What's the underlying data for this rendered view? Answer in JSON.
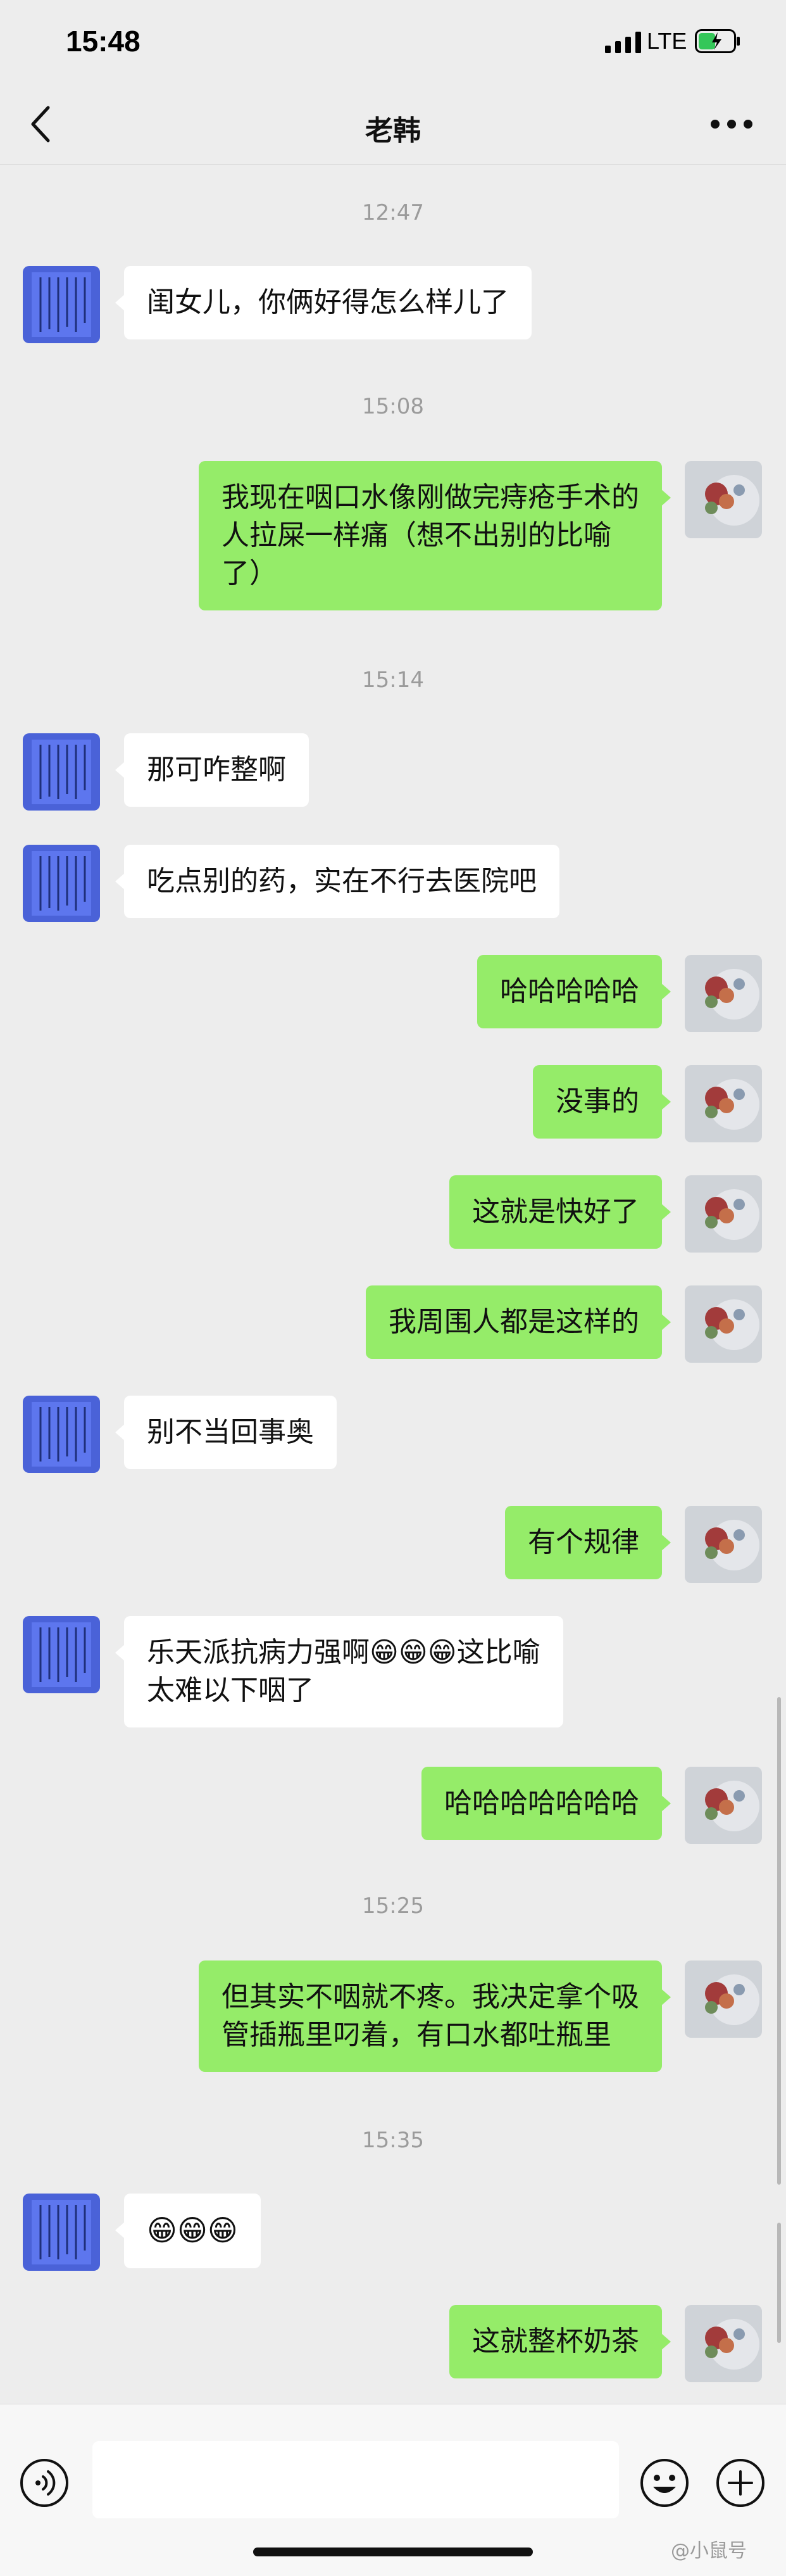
{
  "status_bar": {
    "time": "15:48",
    "network": "LTE",
    "icons": [
      "signal-icon",
      "battery-charging-icon"
    ]
  },
  "nav": {
    "title": "老韩",
    "back_icon": "chevron-left-icon",
    "more_icon": "more-dots-icon"
  },
  "messages": [
    {
      "type": "time",
      "text": "12:47"
    },
    {
      "type": "msg",
      "side": "left",
      "text": "闺女儿，你俩好得怎么样儿了"
    },
    {
      "type": "time",
      "text": "15:08"
    },
    {
      "type": "msg",
      "side": "right",
      "lines": [
        "我现在咽口水像刚做完痔疮手术的",
        "人拉屎一样痛（想不出别的比喻",
        "了）"
      ]
    },
    {
      "type": "time",
      "text": "15:14"
    },
    {
      "type": "msg",
      "side": "left",
      "text": "那可咋整啊"
    },
    {
      "type": "msg",
      "side": "left",
      "text": "吃点别的药，实在不行去医院吧"
    },
    {
      "type": "msg",
      "side": "right",
      "text": "哈哈哈哈哈"
    },
    {
      "type": "msg",
      "side": "right",
      "text": "没事的"
    },
    {
      "type": "msg",
      "side": "right",
      "text": "这就是快好了"
    },
    {
      "type": "msg",
      "side": "right",
      "text": "我周围人都是这样的"
    },
    {
      "type": "msg",
      "side": "left",
      "text": "别不当回事奥"
    },
    {
      "type": "msg",
      "side": "right",
      "text": "有个规律"
    },
    {
      "type": "msg",
      "side": "left",
      "lines": [
        "乐天派抗病力强啊😁😁😁这比喻",
        "太难以下咽了"
      ]
    },
    {
      "type": "msg",
      "side": "right",
      "text": "哈哈哈哈哈哈哈"
    },
    {
      "type": "time",
      "text": "15:25"
    },
    {
      "type": "msg",
      "side": "right",
      "lines": [
        "但其实不咽就不疼。我决定拿个吸",
        "管插瓶里叼着，有口水都吐瓶里"
      ]
    },
    {
      "type": "time",
      "text": "15:35"
    },
    {
      "type": "msg",
      "side": "left",
      "text": "😁😁😁"
    },
    {
      "type": "msg",
      "side": "right",
      "text": "这就整杯奶茶"
    }
  ],
  "input_bar": {
    "placeholder": "",
    "voice_icon": "voice-icon",
    "emoji_icon": "emoji-icon",
    "plus_icon": "plus-icon"
  },
  "watermark": "@小鼠号",
  "colors": {
    "background": "#ededed",
    "bubble_self": "#95ec69",
    "bubble_other": "#ffffff",
    "timestamp": "#9b9b9b"
  }
}
